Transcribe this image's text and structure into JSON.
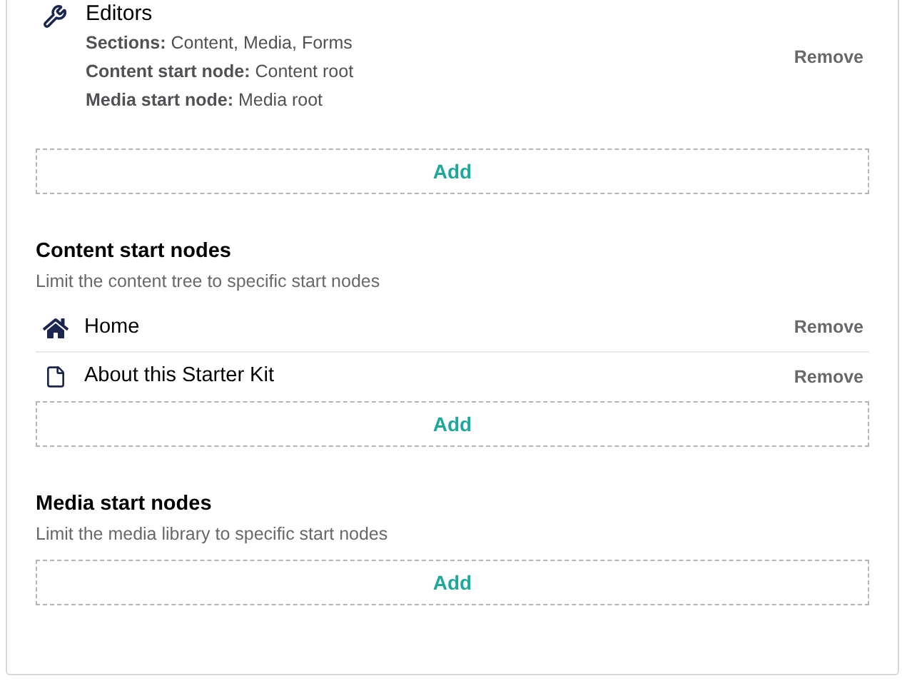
{
  "groups": [
    {
      "name": "Editors",
      "details": [
        "**Sections:** Content, Media, Forms",
        "**Content start node:** Content root",
        "**Media start node:** Media root"
      ],
      "remove": "Remove"
    }
  ],
  "groups_add": "Add",
  "sections": [
    {
      "title": "Content start nodes",
      "description": "Limit the content tree to specific start nodes",
      "nodes": [
        {
          "kind": "home",
          "name": "Home",
          "remove": "Remove"
        },
        {
          "kind": "document",
          "name": "About this Starter Kit",
          "remove": "Remove"
        }
      ],
      "add": "Add"
    },
    {
      "title": "Media start nodes",
      "description": "Limit the media library to specific start nodes",
      "add": "Add"
    }
  ]
}
